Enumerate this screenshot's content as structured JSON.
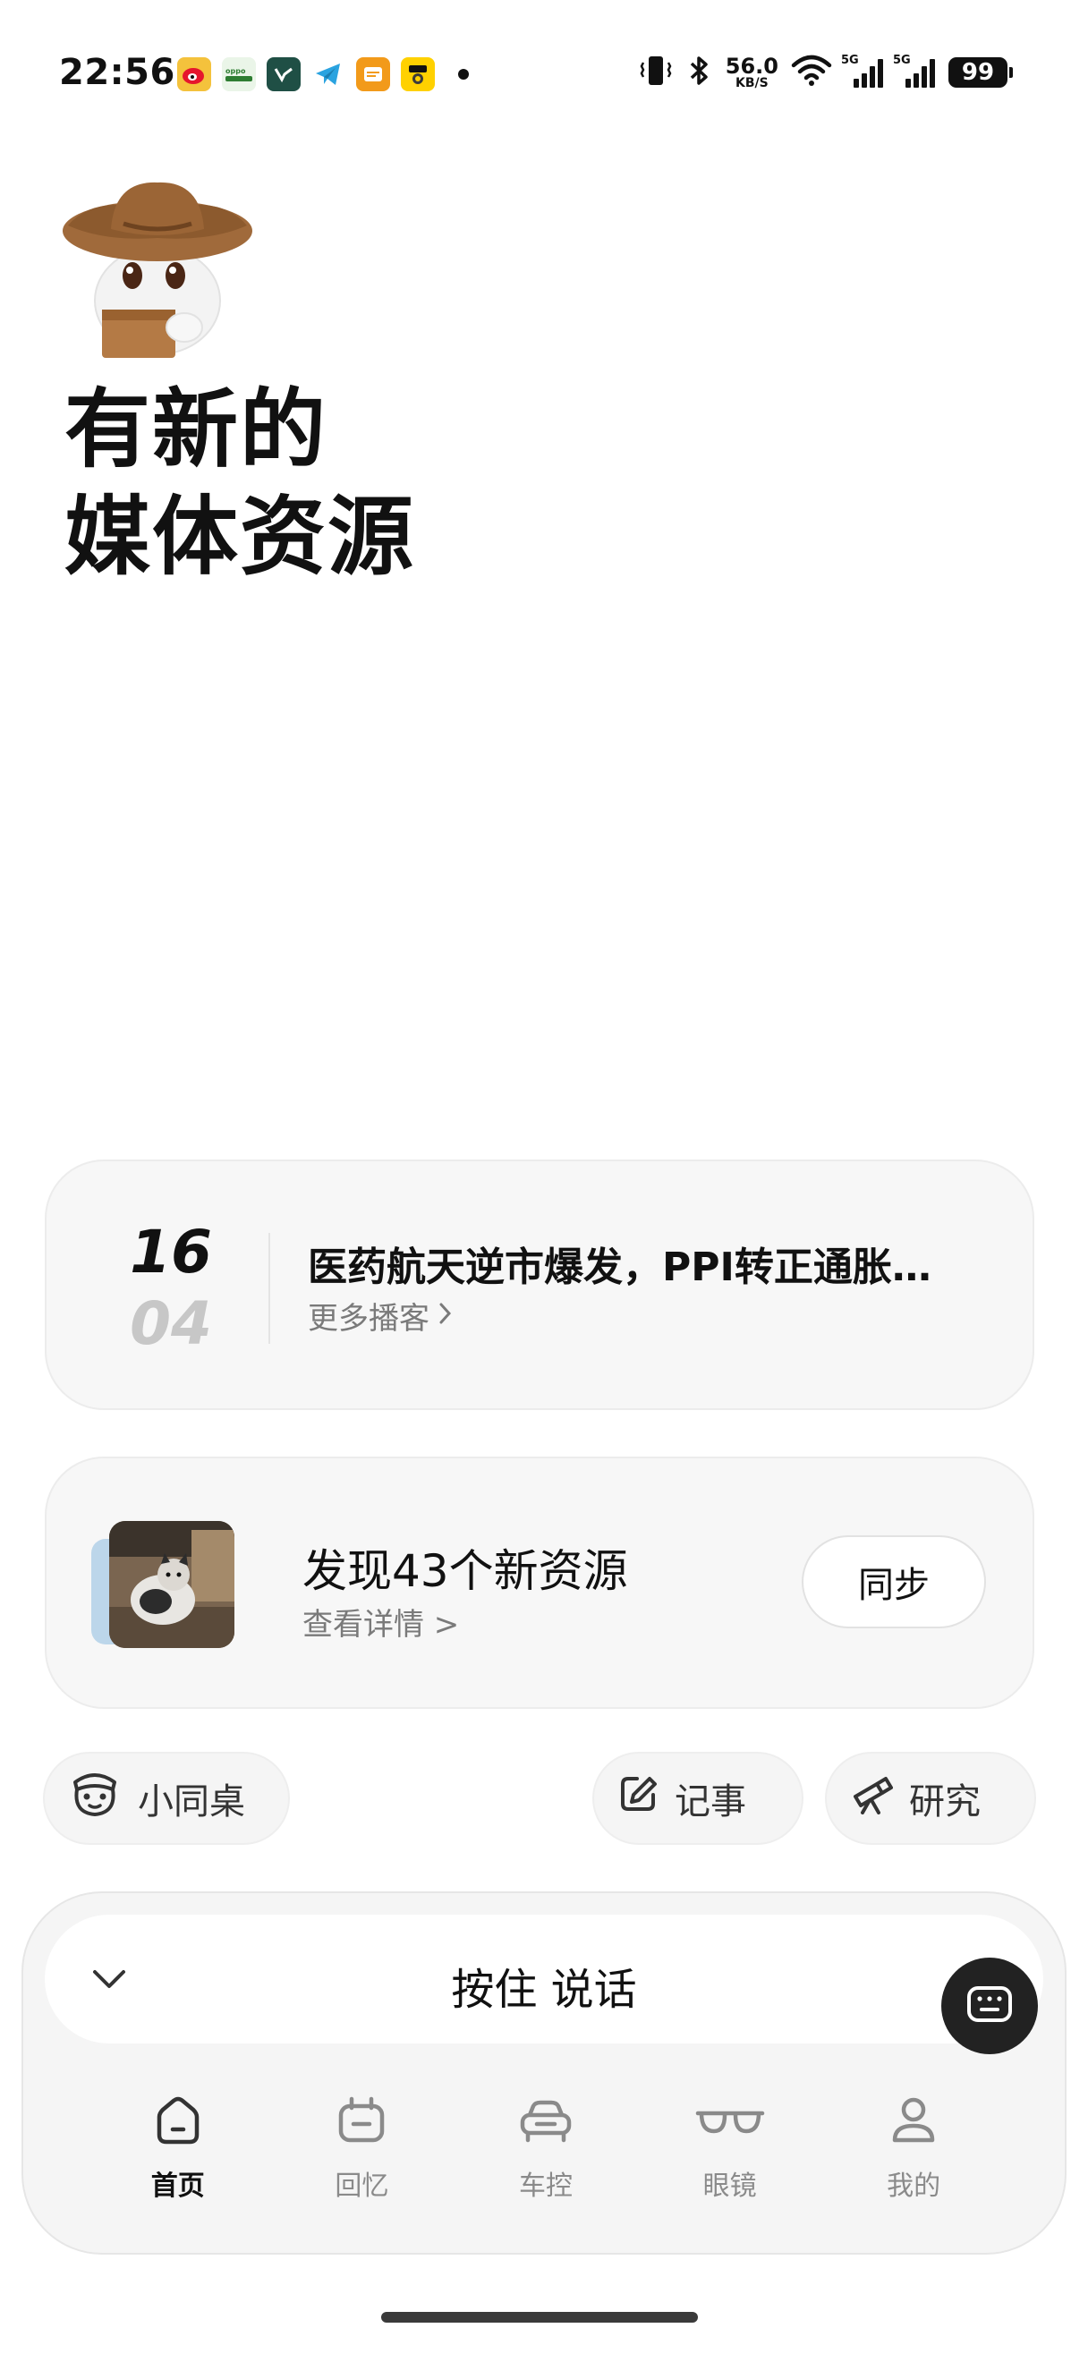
{
  "status_bar": {
    "time": "22:56",
    "notifications": [
      "weibo-icon",
      "oppo-icon",
      "app-v-icon",
      "telegram-icon",
      "notes-icon",
      "meituan-icon"
    ],
    "net_speed_value": "56.0",
    "net_speed_unit": "KB/S",
    "sim1_label": "5G",
    "sim2_label": "5G",
    "battery": "99"
  },
  "headline": {
    "line1": "有新的",
    "line2": "媒体资源"
  },
  "podcast_card": {
    "day": "16",
    "month": "04",
    "title": "医药航天逆市爆发，PPI转正通胀…",
    "more_label": "更多播客"
  },
  "resource_card": {
    "title": "发现43个新资源",
    "subtitle": "查看详情 >",
    "sync_label": "同步"
  },
  "chips": {
    "tongzhuo": "小同桌",
    "jishi": "记事",
    "yanjiu": "研究"
  },
  "voice": {
    "label": "按住 说话"
  },
  "tabs": [
    {
      "label": "首页",
      "icon": "home-icon",
      "active": true
    },
    {
      "label": "回忆",
      "icon": "memory-icon",
      "active": false
    },
    {
      "label": "车控",
      "icon": "car-icon",
      "active": false
    },
    {
      "label": "眼镜",
      "icon": "glasses-icon",
      "active": false
    },
    {
      "label": "我的",
      "icon": "profile-icon",
      "active": false
    }
  ],
  "colors": {
    "card_bg": "#f7f7f7",
    "text_primary": "#111111",
    "text_secondary": "#7a7a7a",
    "keyboard_button": "#222222"
  }
}
